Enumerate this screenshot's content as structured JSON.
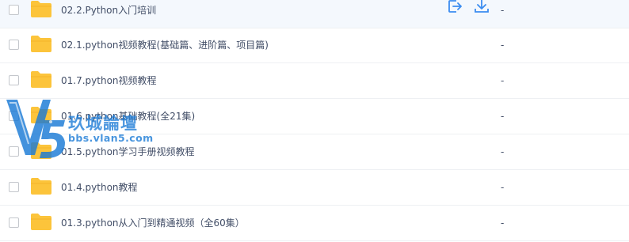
{
  "files": [
    {
      "name": "02.2.Python入门培训",
      "size": "-",
      "hovered": true
    },
    {
      "name": "02.1.python视频教程(基础篇、进阶篇、项目篇)",
      "size": "-"
    },
    {
      "name": "01.7.python视频教程",
      "size": "-"
    },
    {
      "name": "01.6.python基础教程(全21集)",
      "size": "-"
    },
    {
      "name": "01.5.python学习手册视频教程",
      "size": "-"
    },
    {
      "name": "01.4.python教程",
      "size": "-"
    },
    {
      "name": "01.3.python从入门到精通视频（全60集）",
      "size": "-"
    }
  ],
  "row_actions": {
    "share_icon": "share-out-icon",
    "download_icon": "download-icon"
  },
  "watermark": {
    "logo_text": "V5",
    "title": "玖城論壇",
    "url": "bbs.vlan5.com"
  },
  "colors": {
    "folder": "#fcc43b",
    "accent": "#3b8cf0",
    "text": "#424e67",
    "hover_row": "#f4f8fd"
  }
}
